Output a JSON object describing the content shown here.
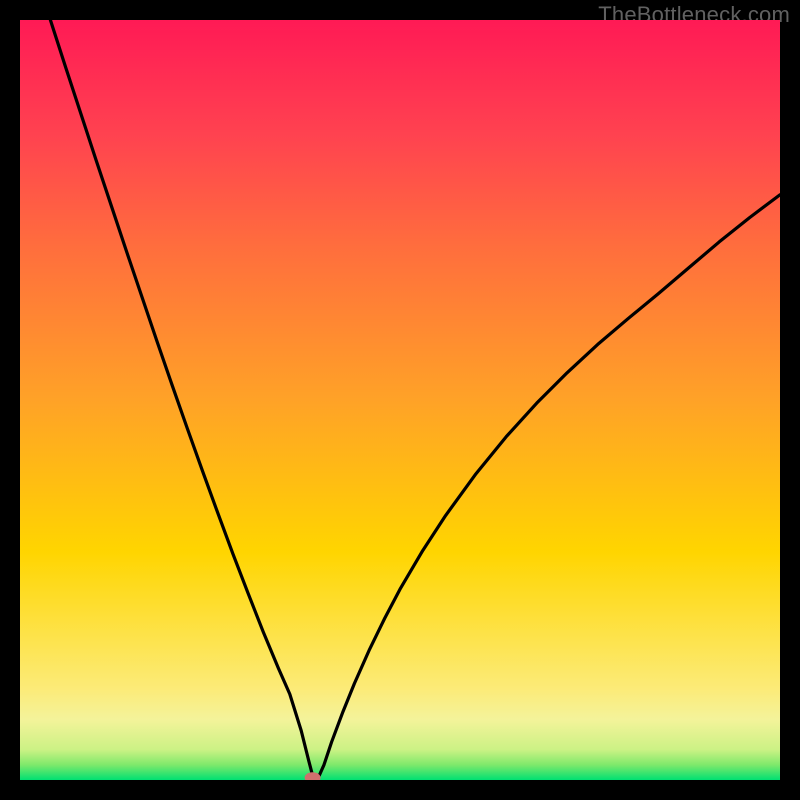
{
  "watermark": "TheBottleneck.com",
  "chart_data": {
    "type": "line",
    "title": "",
    "xlabel": "",
    "ylabel": "",
    "xlim": [
      0,
      100
    ],
    "ylim": [
      0,
      100
    ],
    "gradient_stops": [
      {
        "offset": 0.0,
        "color": "#00e072"
      },
      {
        "offset": 0.02,
        "color": "#7fe96b"
      },
      {
        "offset": 0.04,
        "color": "#ccf285"
      },
      {
        "offset": 0.08,
        "color": "#f4f39a"
      },
      {
        "offset": 0.12,
        "color": "#fceb78"
      },
      {
        "offset": 0.3,
        "color": "#ffd500"
      },
      {
        "offset": 0.5,
        "color": "#ffa227"
      },
      {
        "offset": 0.7,
        "color": "#ff6e3d"
      },
      {
        "offset": 0.85,
        "color": "#ff4250"
      },
      {
        "offset": 1.0,
        "color": "#ff1a55"
      }
    ],
    "marker": {
      "x": 38.5,
      "y": 0.3,
      "color": "#cf6f6d"
    },
    "curve_comment": "V-shaped bottleneck curve. Minimum near x≈38. Left branch starts near top-left (x≈4,y≈100), right branch ends near (x=100,y≈77).",
    "series": [
      {
        "name": "bottleneck-curve",
        "x": [
          4.0,
          6,
          8,
          10,
          12,
          14,
          16,
          18,
          20,
          22,
          24,
          26,
          28,
          30,
          32,
          34,
          35.5,
          37,
          38,
          38.6,
          39.2,
          40,
          41,
          42.5,
          44,
          46,
          48,
          50,
          53,
          56,
          60,
          64,
          68,
          72,
          76,
          80,
          84,
          88,
          92,
          96,
          100
        ],
        "y": [
          100,
          93.8,
          87.7,
          81.6,
          75.6,
          69.6,
          63.7,
          57.8,
          52.0,
          46.3,
          40.7,
          35.2,
          29.8,
          24.6,
          19.5,
          14.7,
          11.3,
          6.5,
          2.5,
          0.2,
          0.2,
          2.0,
          5.0,
          9.0,
          12.7,
          17.2,
          21.3,
          25.1,
          30.2,
          34.8,
          40.3,
          45.2,
          49.6,
          53.6,
          57.3,
          60.7,
          64.0,
          67.4,
          70.8,
          74.0,
          77.0
        ]
      }
    ]
  }
}
